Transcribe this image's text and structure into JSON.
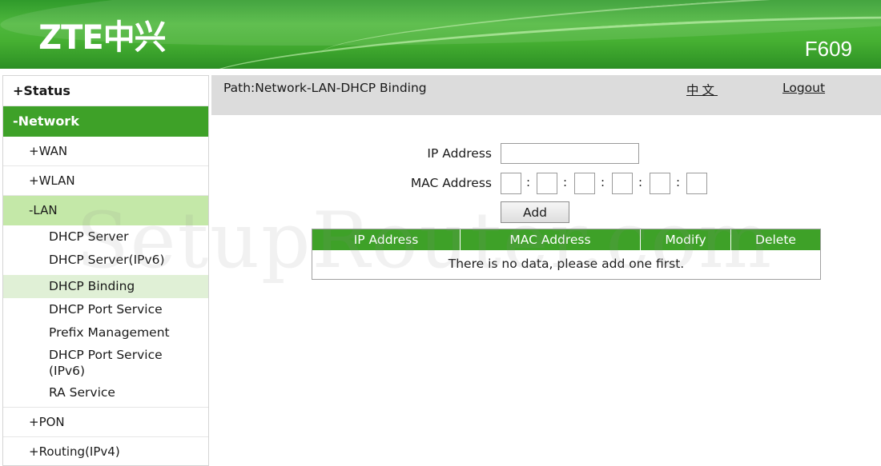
{
  "header": {
    "logo": "ZTE中兴",
    "model": "F609"
  },
  "sidebar": {
    "status": "+Status",
    "network": "-Network",
    "wan": "+WAN",
    "wlan": "+WLAN",
    "lan": "-LAN",
    "lan_items": [
      "DHCP Server",
      "DHCP Server(IPv6)",
      "DHCP Binding",
      "DHCP Port Service",
      "Prefix Management",
      "DHCP Port Service (IPv6)",
      "RA Service"
    ],
    "pon": "+PON",
    "routing": "+Routing(IPv4)"
  },
  "pathbar": {
    "path": "Path:Network-LAN-DHCP Binding",
    "lang": "中文",
    "logout": "Logout"
  },
  "form": {
    "ip_label": "IP Address",
    "mac_label": "MAC Address",
    "mac_separator": ":",
    "add_label": "Add"
  },
  "table": {
    "headers": [
      "IP Address",
      "MAC Address",
      "Modify",
      "Delete"
    ],
    "empty_message": "There is no data, please add one first."
  },
  "watermark": "SetupRouter.com",
  "colors": {
    "brand_green": "#3ea128",
    "header_green": "#46b032",
    "submenu_open": "#c4e8a8",
    "leaf_active": "#e0f0d6"
  }
}
